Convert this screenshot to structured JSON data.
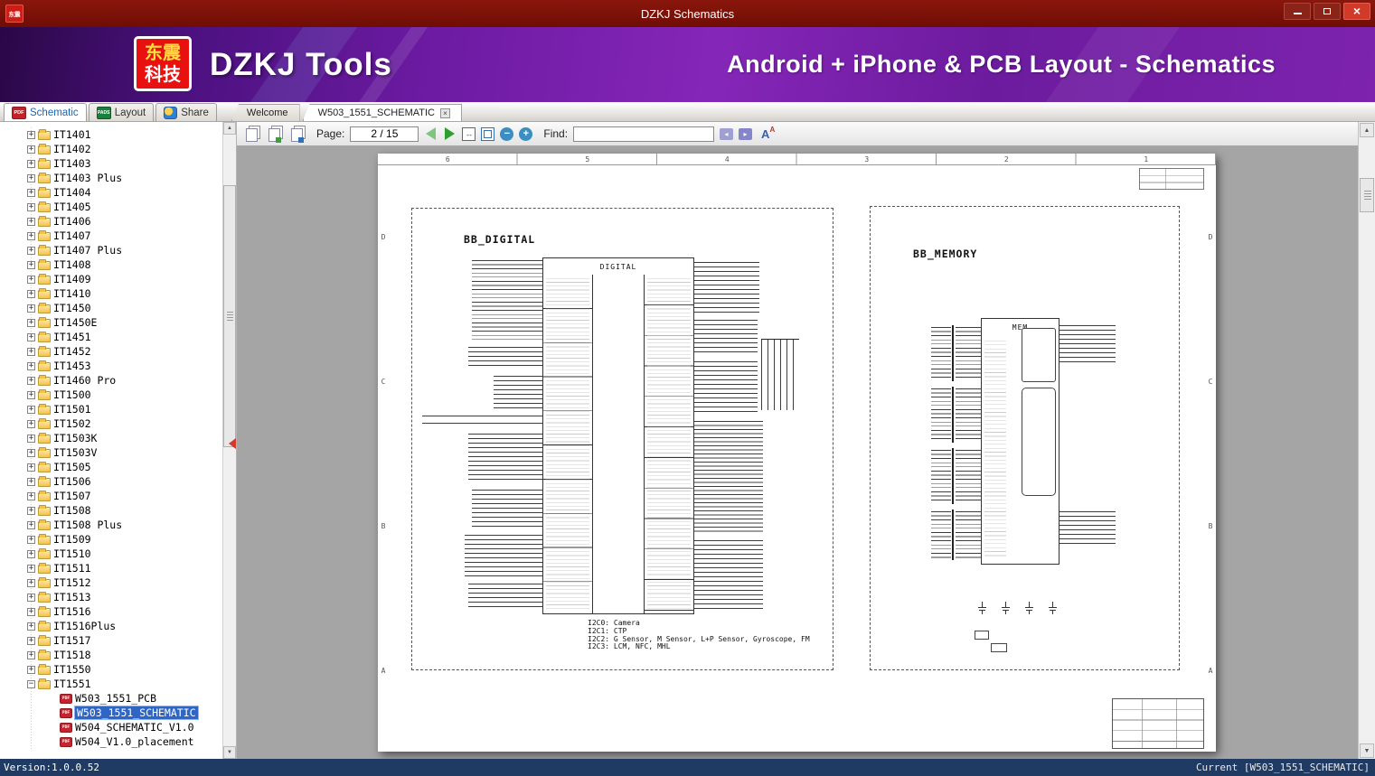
{
  "titlebar": {
    "title": "DZKJ Schematics",
    "app_icon_text": "东震"
  },
  "banner": {
    "logo_top": "东震",
    "logo_bottom": "科技",
    "brand": "DZKJ Tools",
    "tagline": "Android + iPhone & PCB Layout - Schematics",
    "logo_color": "#e8110f",
    "accent_color": "#7d23ae"
  },
  "icons": {
    "pdf": "PDF",
    "pads": "PADS"
  },
  "ribbon_tabs": [
    {
      "label": "Schematic"
    },
    {
      "label": "Layout"
    },
    {
      "label": "Share"
    }
  ],
  "doc_tabs": {
    "welcome": "Welcome",
    "active": "W503_1551_SCHEMATIC"
  },
  "toolbar": {
    "page_label": "Page:",
    "page_value": "2 / 15",
    "find_label": "Find:",
    "find_value": "",
    "font_icon": "A",
    "font_icon_small": "A"
  },
  "tree": {
    "folders": [
      "IT1401",
      "IT1402",
      "IT1403",
      "IT1403 Plus",
      "IT1404",
      "IT1405",
      "IT1406",
      "IT1407",
      "IT1407 Plus",
      "IT1408",
      "IT1409",
      "IT1410",
      "IT1450",
      "IT1450E",
      "IT1451",
      "IT1452",
      "IT1453",
      "IT1460 Pro",
      "IT1500",
      "IT1501",
      "IT1502",
      "IT1503K",
      "IT1503V",
      "IT1505",
      "IT1506",
      "IT1507",
      "IT1508",
      "IT1508 Plus",
      "IT1509",
      "IT1510",
      "IT1511",
      "IT1512",
      "IT1513",
      "IT1516",
      "IT1516Plus",
      "IT1517",
      "IT1518",
      "IT1550"
    ],
    "expanded_folder": "IT1551",
    "children": [
      {
        "label": "W503_1551_PCB",
        "selected": false
      },
      {
        "label": "W503_1551_SCHEMATIC",
        "selected": true
      },
      {
        "label": "W504_SCHEMATIC_V1.0",
        "selected": false
      },
      {
        "label": "W504_V1.0_placement",
        "selected": false
      }
    ]
  },
  "page": {
    "col_labels": [
      "6",
      "5",
      "4",
      "3",
      "2",
      "1"
    ],
    "row_labels": [
      "D",
      "C",
      "B",
      "A"
    ],
    "digital_block": {
      "title": "BB_DIGITAL",
      "chip_label": "DIGITAL"
    },
    "memory_block": {
      "title": "BB_MEMORY",
      "chip_label": "MEM"
    },
    "notes": [
      "I2C0: Camera",
      "I2C1: CTP",
      "I2C2: G Sensor, M Sensor, L+P Sensor, Gyroscope, FM",
      "I2C3: LCM, NFC, MHL"
    ]
  },
  "statusbar": {
    "left": "Version:1.0.0.52",
    "right": "Current [W503_1551_SCHEMATIC]"
  }
}
